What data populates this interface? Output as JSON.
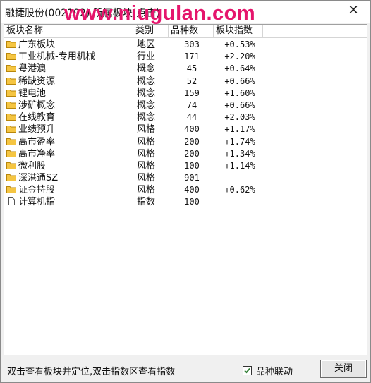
{
  "window": {
    "title": "融捷股份(002192) 所属板块(点击)",
    "watermark": "www.niugulan.com",
    "close_glyph": "✕"
  },
  "table": {
    "columns": [
      "板块名称",
      "类别",
      "品种数",
      "板块指数"
    ],
    "rows": [
      {
        "name": "广东板块",
        "type": "地区",
        "count": "303",
        "index": "+0.53%",
        "icon": "folder-icon"
      },
      {
        "name": "工业机械-专用机械",
        "type": "行业",
        "count": "171",
        "index": "+2.20%",
        "icon": "folder-icon"
      },
      {
        "name": "粤港澳",
        "type": "概念",
        "count": "45",
        "index": "+0.64%",
        "icon": "folder-icon"
      },
      {
        "name": "稀缺资源",
        "type": "概念",
        "count": "52",
        "index": "+0.66%",
        "icon": "folder-icon"
      },
      {
        "name": "锂电池",
        "type": "概念",
        "count": "159",
        "index": "+1.60%",
        "icon": "folder-icon"
      },
      {
        "name": "涉矿概念",
        "type": "概念",
        "count": "74",
        "index": "+0.66%",
        "icon": "folder-icon"
      },
      {
        "name": "在线教育",
        "type": "概念",
        "count": "44",
        "index": "+2.03%",
        "icon": "folder-icon"
      },
      {
        "name": "业绩预升",
        "type": "风格",
        "count": "400",
        "index": "+1.17%",
        "icon": "folder-icon"
      },
      {
        "name": "高市盈率",
        "type": "风格",
        "count": "200",
        "index": "+1.74%",
        "icon": "folder-icon"
      },
      {
        "name": "高市净率",
        "type": "风格",
        "count": "200",
        "index": "+1.34%",
        "icon": "folder-icon"
      },
      {
        "name": "微利股",
        "type": "风格",
        "count": "100",
        "index": "+1.14%",
        "icon": "folder-icon"
      },
      {
        "name": "深港通SZ",
        "type": "风格",
        "count": "901",
        "index": "",
        "icon": "folder-icon"
      },
      {
        "name": "证金持股",
        "type": "风格",
        "count": "400",
        "index": "+0.62%",
        "icon": "folder-icon"
      },
      {
        "name": "计算机指",
        "type": "指数",
        "count": "100",
        "index": "",
        "icon": "document-icon"
      }
    ]
  },
  "footer": {
    "hint": "双击查看板块并定位,双击指数区查看指数",
    "checkbox_label": "品种联动",
    "checkbox_checked": true,
    "close_button": "关闭"
  },
  "colors": {
    "watermark": "#e5156c",
    "folder_fill": "#f5c542",
    "folder_edge": "#b8860b",
    "checkmark": "#2e7d32"
  }
}
